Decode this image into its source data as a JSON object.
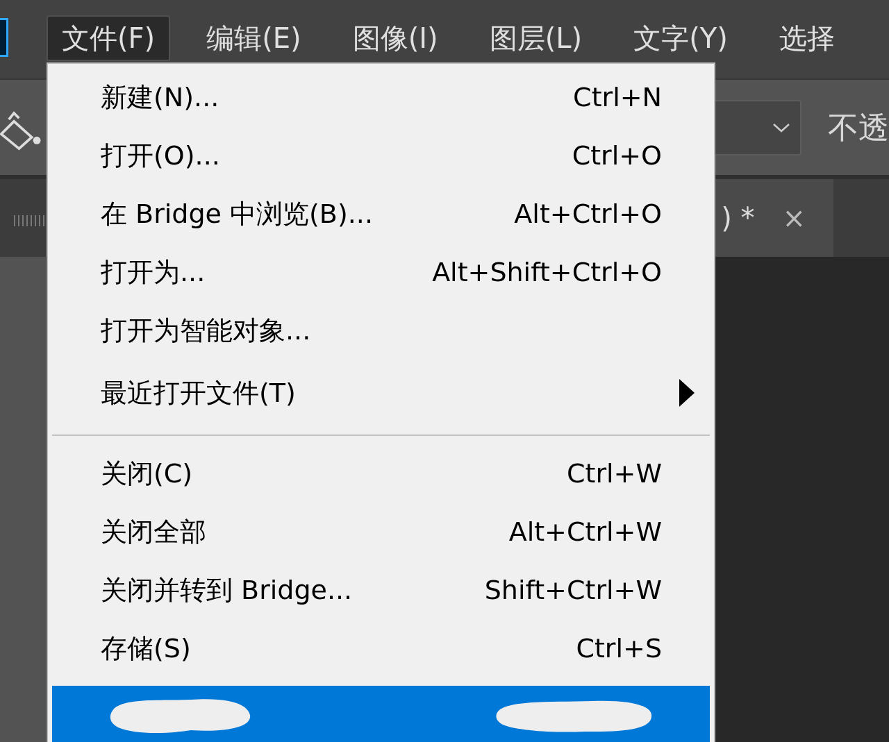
{
  "menubar": {
    "items": [
      {
        "label": "文件(F)",
        "selected": true
      },
      {
        "label": "编辑(E)",
        "selected": false
      },
      {
        "label": "图像(I)",
        "selected": false
      },
      {
        "label": "图层(L)",
        "selected": false
      },
      {
        "label": "文字(Y)",
        "selected": false
      },
      {
        "label": "选择",
        "selected": false
      }
    ]
  },
  "options_bar": {
    "opacity_label": "不透"
  },
  "document_tab": {
    "title": ") *",
    "close": "×"
  },
  "file_menu": {
    "items": [
      {
        "kind": "item",
        "label": "新建(N)...",
        "shortcut": "Ctrl+N",
        "selected": false
      },
      {
        "kind": "item",
        "label": "打开(O)...",
        "shortcut": "Ctrl+O",
        "selected": false
      },
      {
        "kind": "item",
        "label": "在 Bridge 中浏览(B)...",
        "shortcut": "Alt+Ctrl+O",
        "selected": false
      },
      {
        "kind": "item",
        "label": "打开为...",
        "shortcut": "Alt+Shift+Ctrl+O",
        "selected": false
      },
      {
        "kind": "item",
        "label": "打开为智能对象...",
        "selected": false
      },
      {
        "kind": "submenu",
        "label": "最近打开文件(T)",
        "selected": false
      },
      {
        "kind": "separator"
      },
      {
        "kind": "item",
        "label": "关闭(C)",
        "shortcut": "Ctrl+W",
        "selected": false
      },
      {
        "kind": "item",
        "label": "关闭全部",
        "shortcut": "Alt+Ctrl+W",
        "selected": false
      },
      {
        "kind": "item",
        "label": "关闭并转到 Bridge...",
        "shortcut": "Shift+Ctrl+W",
        "selected": false
      },
      {
        "kind": "item",
        "label": "存储(S)",
        "shortcut": "Ctrl+S",
        "selected": false
      },
      {
        "kind": "redacted",
        "selected": true
      }
    ]
  }
}
